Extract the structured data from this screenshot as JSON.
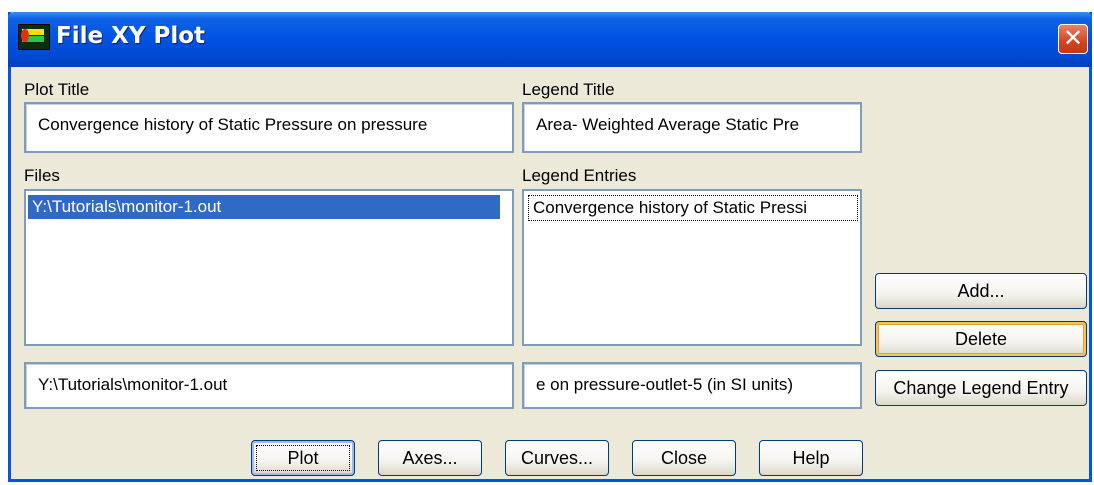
{
  "window": {
    "title": "File XY Plot",
    "app_icon": "fluent-app-icon",
    "close_glyph": "✕"
  },
  "plot_title": {
    "label": "Plot Title",
    "value": "Convergence history of Static Pressure on pressure"
  },
  "legend_title": {
    "label": "Legend Title",
    "value": "Area- Weighted Average Static Pre"
  },
  "files": {
    "label": "Files",
    "items": [
      "Y:\\Tutorials\\monitor-1.out"
    ],
    "selected_index": 0,
    "edit_value": "Y:\\Tutorials\\monitor-1.out"
  },
  "legend_entries": {
    "label": "Legend Entries",
    "items": [
      "Convergence history of Static Pressi"
    ],
    "edit_value": "e on pressure-outlet-5 (in SI units)"
  },
  "side_buttons": {
    "add": "Add...",
    "delete": "Delete",
    "change_legend_entry": "Change Legend Entry"
  },
  "bottom_buttons": {
    "plot": "Plot",
    "axes": "Axes...",
    "curves": "Curves...",
    "close": "Close",
    "help": "Help"
  },
  "colors": {
    "titlebar": "#0054e3",
    "dialog_bg": "#ece9d8",
    "selection": "#316ac5",
    "field_border": "#7f9db9"
  }
}
